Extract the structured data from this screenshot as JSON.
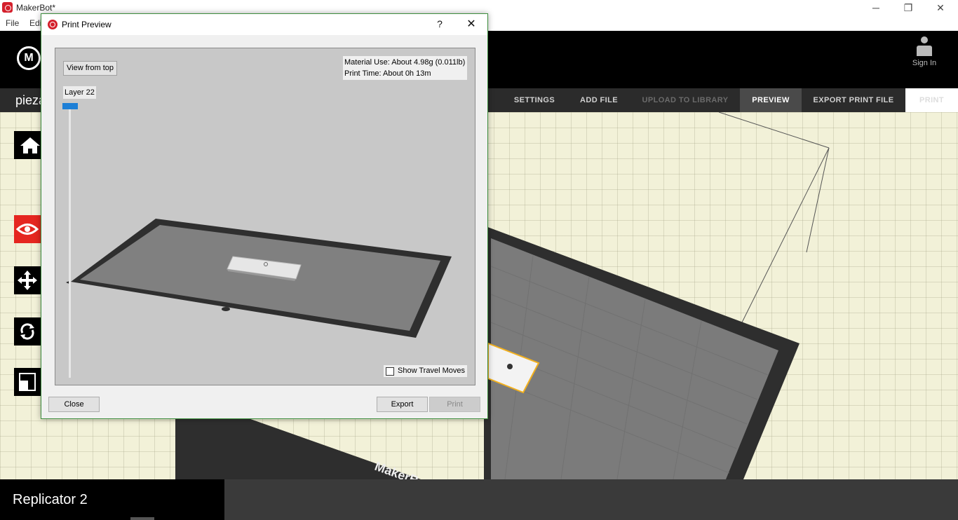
{
  "window": {
    "title": "MakerBot*",
    "controls": {
      "minimize": "─",
      "restore": "❐",
      "close": "✕"
    }
  },
  "menu": [
    "File",
    "Edi"
  ],
  "header": {
    "sign_in": "Sign In"
  },
  "navbar": {
    "file_name": "pieza",
    "items": [
      {
        "label": "SETTINGS",
        "state": "normal"
      },
      {
        "label": "ADD FILE",
        "state": "normal"
      },
      {
        "label": "UPLOAD TO LIBRARY",
        "state": "disabled"
      },
      {
        "label": "PREVIEW",
        "state": "active"
      },
      {
        "label": "EXPORT PRINT FILE",
        "state": "normal"
      },
      {
        "label": "PRINT",
        "state": "disabled"
      }
    ]
  },
  "tools": [
    "home-icon",
    "eye-icon",
    "move-icon",
    "rotate-icon",
    "scale-icon"
  ],
  "bottom": {
    "printer": "Replicator 2"
  },
  "dialog": {
    "title": "Print Preview",
    "help": "?",
    "close_glyph": "✕",
    "view_from_top": "View from top",
    "layer": "Layer 22",
    "material_use": "Material Use: About 4.98g (0.011lb)",
    "print_time": "Print Time: About 0h 13m",
    "show_travel_moves": "Show Travel Moves",
    "show_travel_checked": false,
    "buttons": {
      "close": "Close",
      "export": "Export",
      "print": "Print"
    }
  },
  "colors": {
    "accent_red": "#e52620",
    "slider_blue": "#1d7fd6",
    "selection_yellow": "#f2b01e",
    "grid_background": "#f2f1d8"
  },
  "build_plate_brand": "MakerB"
}
